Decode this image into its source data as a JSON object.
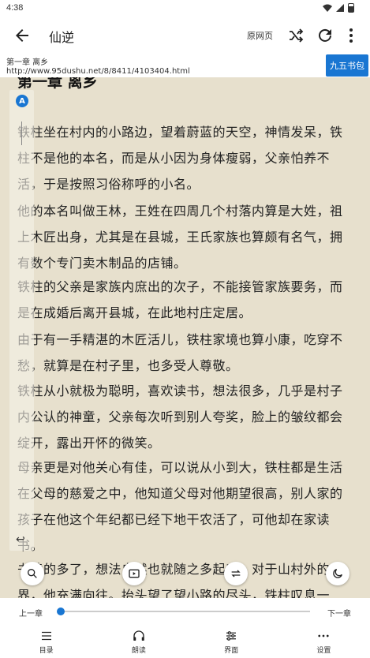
{
  "status": {
    "time": "4:38"
  },
  "toolbar": {
    "title": "仙逆",
    "source_label": "原网页"
  },
  "chapter_info": {
    "name": "第一章 离乡",
    "url": "http://www.95dushu.net/8/8411/4103404.html",
    "site_badge": "九五书包"
  },
  "content": {
    "chapter_title": "第一章 离乡",
    "paragraphs": [
      "铁柱坐在村内的小路边，望着蔚蓝的天空，神情发呆，铁柱不是他的本名，而是从小因为身体瘦弱，父亲怕养不活，于是按照习俗称呼的小名。",
      "他的本名叫做王林，王姓在四周几个村落内算是大姓，祖上木匠出身，尤其是在县城，王氏家族也算颇有名气，拥有数个专门卖木制品的店铺。",
      "铁柱的父亲是家族内庶出的次子，不能接管家族要务，而是在成婚后离开县城，在此地村庄定居。",
      "由于有一手精湛的木匠活儿，铁柱家境也算小康，吃穿不愁，就算是在村子里，也多受人尊敬。",
      "铁柱从小就极为聪明，喜欢读书，想法很多，几乎是村子内公认的神童，父亲每次听到别人夸奖，脸上的皱纹都会绽开，露出开怀的微笑。",
      "母亲更是对他关心有佳，可以说从小到大，铁柱都是生活在父母的慈爱之中，他知道父母对他期望很高，别人家的孩子在他这个年纪都已经下地干农活了，可他却在家读书。",
      "书读的多了，想法自然也就随之多起来，对于山村外的世界，他充满向往。抬头望了望小路的尽头，铁柱叹息一"
    ]
  },
  "progress": {
    "prev_label": "上一章",
    "next_label": "下一章",
    "value": 0.0
  },
  "nav": {
    "items": [
      {
        "label": "目录",
        "icon": "menu-icon"
      },
      {
        "label": "朗读",
        "icon": "headphones-icon"
      },
      {
        "label": "界面",
        "icon": "sliders-icon"
      },
      {
        "label": "设置",
        "icon": "more-horizontal-icon"
      }
    ]
  },
  "colors": {
    "page_background": "#e7e0cd",
    "accent": "#1976d2"
  }
}
